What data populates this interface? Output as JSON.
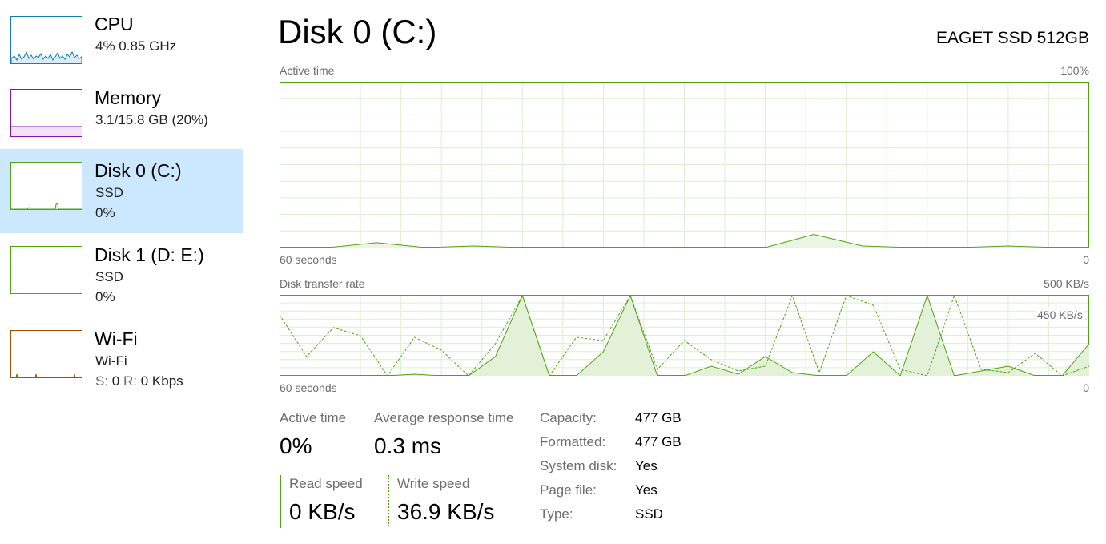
{
  "sidebar": {
    "items": [
      {
        "title": "CPU",
        "line1": "4%  0.85 GHz"
      },
      {
        "title": "Memory",
        "line1": "3.1/15.8 GB (20%)"
      },
      {
        "title": "Disk 0 (C:)",
        "line1": "SSD",
        "line2": "0%"
      },
      {
        "title": "Disk 1 (D: E:)",
        "line1": "SSD",
        "line2": "0%"
      },
      {
        "title": "Wi-Fi",
        "line1": "Wi-Fi",
        "send_label": "S:",
        "send_value": "0",
        "recv_label": "R:",
        "recv_value": "0 Kbps"
      }
    ]
  },
  "main": {
    "title": "Disk 0 (C:)",
    "model": "EAGET SSD 512GB",
    "active_chart": {
      "label": "Active time",
      "max_label": "100%",
      "time_label": "60 seconds",
      "min_label": "0"
    },
    "transfer_chart": {
      "label": "Disk transfer rate",
      "max_label": "500 KB/s",
      "inner_label": "450 KB/s",
      "time_label": "60 seconds",
      "min_label": "0"
    },
    "stats": {
      "active_time_label": "Active time",
      "active_time_value": "0%",
      "avg_response_label": "Average response time",
      "avg_response_value": "0.3 ms",
      "read_speed_label": "Read speed",
      "read_speed_value": "0 KB/s",
      "write_speed_label": "Write speed",
      "write_speed_value": "36.9 KB/s"
    },
    "properties": [
      {
        "label": "Capacity:",
        "value": "477 GB"
      },
      {
        "label": "Formatted:",
        "value": "477 GB"
      },
      {
        "label": "System disk:",
        "value": "Yes"
      },
      {
        "label": "Page file:",
        "value": "Yes"
      },
      {
        "label": "Type:",
        "value": "SSD"
      }
    ]
  },
  "colors": {
    "selection": "#cce8ff",
    "cpu": "#117dbb",
    "memory": "#8b12ae",
    "disk": "#4da60c",
    "wifi": "#a74f01"
  },
  "chart_data": [
    {
      "type": "area",
      "title": "Active time",
      "x_label": "60 seconds",
      "ylim": [
        0,
        100
      ],
      "unit": "%",
      "x": [
        60,
        56.4,
        52.8,
        49.2,
        45.6,
        42,
        38.4,
        34.8,
        31.2,
        27.6,
        24,
        20.4,
        16.8,
        13.2,
        9.6,
        6,
        2.4,
        0
      ],
      "values": [
        0,
        0,
        3,
        0,
        1,
        0,
        0,
        0,
        0,
        0,
        0,
        8,
        1,
        0,
        0,
        1,
        0,
        0
      ]
    },
    {
      "type": "line",
      "title": "Disk transfer rate",
      "x_label": "60 seconds",
      "ylim": [
        0,
        500
      ],
      "unit": "KB/s",
      "gridline_label": "450 KB/s",
      "series": [
        {
          "style": "solid",
          "x": [
            60,
            58,
            56,
            54,
            52,
            50,
            48,
            46,
            44,
            42,
            40,
            38,
            36,
            34,
            32,
            30,
            28,
            26,
            24,
            22,
            20,
            18,
            16,
            14,
            12,
            10,
            8,
            6,
            4,
            2,
            0
          ],
          "values": [
            0,
            0,
            0,
            0,
            0,
            10,
            0,
            0,
            120,
            500,
            0,
            0,
            150,
            500,
            0,
            0,
            60,
            10,
            120,
            20,
            0,
            0,
            150,
            0,
            500,
            0,
            30,
            60,
            0,
            0,
            200
          ]
        },
        {
          "style": "dashed",
          "x": [
            60,
            58,
            56,
            54,
            52,
            50,
            48,
            46,
            44,
            42,
            40,
            38,
            36,
            34,
            32,
            30,
            28,
            26,
            24,
            22,
            20,
            18,
            16,
            14,
            12,
            10,
            8,
            6,
            4,
            2,
            0
          ],
          "values": [
            380,
            120,
            300,
            250,
            0,
            240,
            160,
            0,
            200,
            500,
            0,
            240,
            220,
            500,
            40,
            220,
            100,
            30,
            60,
            500,
            20,
            500,
            440,
            40,
            0,
            500,
            40,
            20,
            140,
            0,
            60
          ]
        }
      ]
    }
  ]
}
